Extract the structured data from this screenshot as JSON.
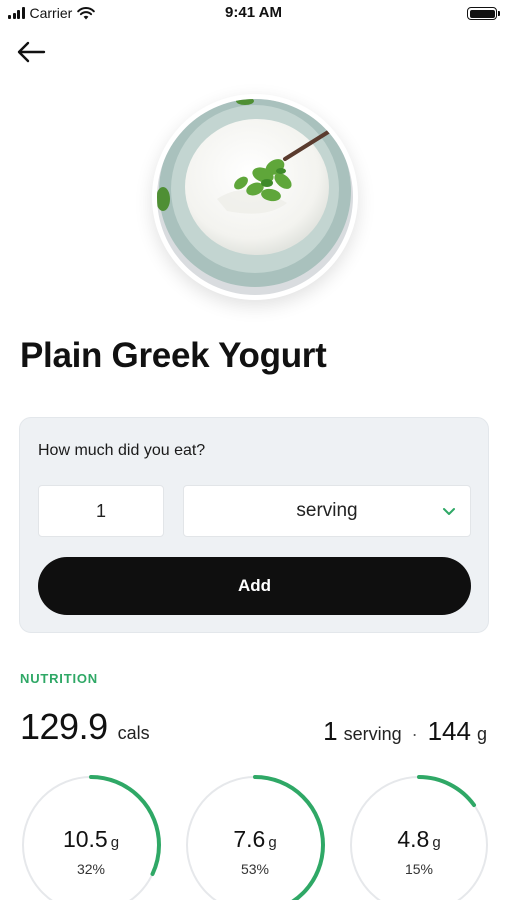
{
  "status_bar": {
    "carrier": "Carrier",
    "time": "9:41 AM"
  },
  "food": {
    "title": "Plain Greek Yogurt"
  },
  "serving_form": {
    "question": "How much did you eat?",
    "quantity": "1",
    "unit": "serving",
    "add_label": "Add"
  },
  "nutrition": {
    "label": "NUTRITION",
    "calories": "129.9",
    "calories_unit": "cals",
    "serving_qty": "1",
    "serving_unit": "serving",
    "separator": "·",
    "weight": "144",
    "weight_unit": "g",
    "macros": [
      {
        "value": "10.5",
        "unit": "g",
        "percent": "32%",
        "fraction": 0.32
      },
      {
        "value": "7.6",
        "unit": "g",
        "percent": "53%",
        "fraction": 0.53
      },
      {
        "value": "4.8",
        "unit": "g",
        "percent": "15%",
        "fraction": 0.15
      }
    ]
  },
  "colors": {
    "accent_green": "#2fa866",
    "ring_track": "#e6e8eb",
    "card_bg": "#eef1f4",
    "button_bg": "#0f0f0f"
  }
}
